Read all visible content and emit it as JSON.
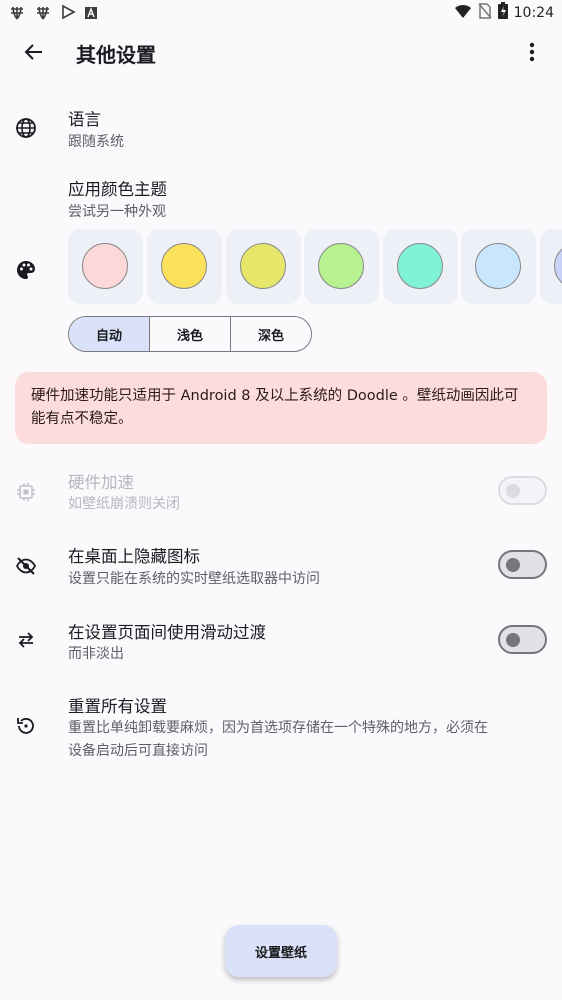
{
  "status_bar": {
    "time": "10:24",
    "left_icons": [
      "bug-icon",
      "bug-icon",
      "play-store-icon",
      "font-icon"
    ],
    "right_icons": [
      "wifi-icon",
      "no-sim-icon",
      "battery-charging-icon"
    ]
  },
  "app_bar": {
    "title": "其他设置"
  },
  "settings": {
    "language": {
      "title": "语言",
      "subtitle": "跟随系统"
    },
    "theme": {
      "title": "应用颜色主题",
      "subtitle": "尝试另一种外观"
    },
    "swatch_colors": [
      "#fdd8d8",
      "#fbe15a",
      "#e6e66a",
      "#b8f18f",
      "#7ff2d7",
      "#c8e6fd",
      "#c7d3f7"
    ],
    "theme_modes": [
      "自动",
      "浅色",
      "深色"
    ],
    "selected_mode": "自动",
    "warning": "硬件加速功能只适用于 Android 8 及以上系统的 Doodle 。壁纸动画因此可能有点不稳定。",
    "hardware_accel": {
      "title": "硬件加速",
      "subtitle": "如壁纸崩溃则关闭",
      "enabled": false,
      "disabled": true
    },
    "hide_icon": {
      "title": "在桌面上隐藏图标",
      "subtitle": "设置只能在系统的实时壁纸选取器中访问",
      "enabled": false
    },
    "slide_transition": {
      "title": "在设置页面间使用滑动过渡",
      "subtitle": "而非淡出",
      "enabled": false
    },
    "reset": {
      "title": "重置所有设置",
      "subtitle_line1": "重置比单纯卸载要麻烦，因为首选项存储在一个特殊的地方，必须在",
      "subtitle_line2": "设备启动后可直接访问"
    }
  },
  "fab": {
    "label": "设置壁纸"
  },
  "colors": {
    "accent_container": "#dae2f9",
    "warning_bg": "#fddcdc",
    "background": "#fcf9fd"
  }
}
